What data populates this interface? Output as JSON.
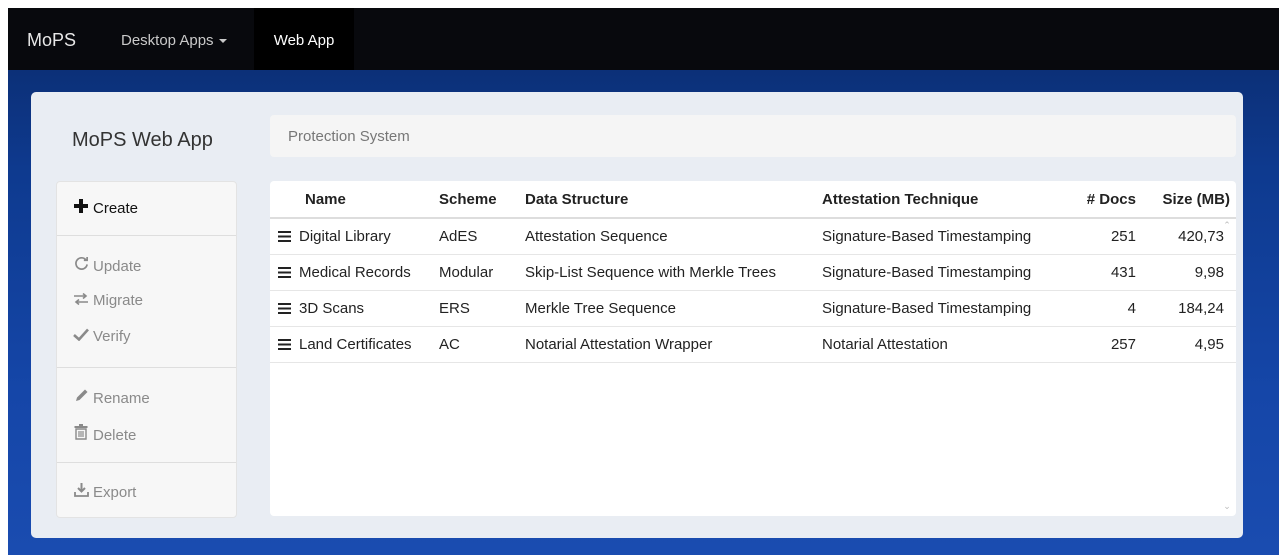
{
  "navbar": {
    "brand": "MoPS",
    "desktop_apps": "Desktop Apps",
    "web_app": "Web App"
  },
  "app_title": "MoPS Web App",
  "breadcrumb": "Protection System",
  "sidebar": {
    "create": "Create",
    "update": "Update",
    "migrate": "Migrate",
    "verify": "Verify",
    "rename": "Rename",
    "delete": "Delete",
    "export": "Export"
  },
  "table": {
    "headers": {
      "name": "Name",
      "scheme": "Scheme",
      "data_structure": "Data Structure",
      "attestation": "Attestation Technique",
      "docs": "# Docs",
      "size": "Size (MB)"
    },
    "rows": [
      {
        "name": "Digital Library",
        "scheme": "AdES",
        "data_structure": "Attestation Sequence",
        "attestation": "Signature-Based Timestamping",
        "docs": "251",
        "size": "420,73"
      },
      {
        "name": "Medical Records",
        "scheme": "Modular",
        "data_structure": "Skip-List Sequence with Merkle Trees",
        "attestation": "Signature-Based Timestamping",
        "docs": "431",
        "size": "9,98"
      },
      {
        "name": "3D Scans",
        "scheme": "ERS",
        "data_structure": "Merkle Tree Sequence",
        "attestation": "Signature-Based Timestamping",
        "docs": "4",
        "size": "184,24"
      },
      {
        "name": "Land Certificates",
        "scheme": "AC",
        "data_structure": "Notarial Attestation Wrapper",
        "attestation": "Notarial Attestation",
        "docs": "257",
        "size": "4,95"
      }
    ]
  },
  "icons": {
    "create": "plus-icon",
    "update": "refresh-icon",
    "migrate": "transfer-icon",
    "verify": "checkmark-icon",
    "rename": "pencil-icon",
    "delete": "trash-icon",
    "export": "download-icon",
    "row": "menu-icon"
  }
}
